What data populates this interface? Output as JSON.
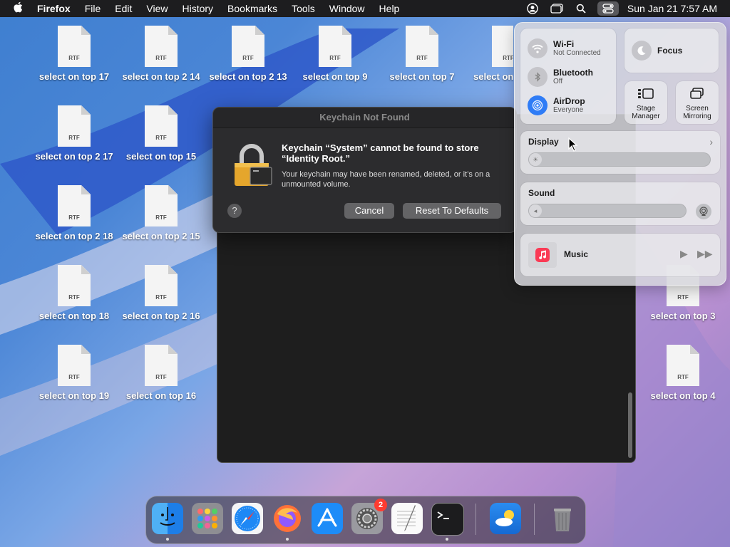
{
  "menubar": {
    "app_name": "Firefox",
    "menus": [
      "File",
      "Edit",
      "View",
      "History",
      "Bookmarks",
      "Tools",
      "Window",
      "Help"
    ],
    "clock": "Sun Jan 21  7:57 AM",
    "icons": [
      "user-icon",
      "window-icon",
      "search-icon",
      "control-center-icon"
    ]
  },
  "desktop": {
    "file_ext": "RTF",
    "files": [
      "select on top 17",
      "select on top 2 14",
      "select on top 2 13",
      "select on top 9",
      "select on top 7",
      "select on",
      "select on top 2 17",
      "select on top 15",
      "select on top 2 18",
      "select on top 2 15",
      "select on top 18",
      "select on top 2 16",
      "select on top 19",
      "select on top 16",
      "select on top 3",
      "select on top 4"
    ]
  },
  "dialog": {
    "title": "Keychain Not Found",
    "heading": "Keychain “System” cannot be found to store “Identity Root.”",
    "body": "Your keychain may have been renamed, deleted, or it’s on a unmounted volume.",
    "help_label": "?",
    "cancel_label": "Cancel",
    "reset_label": "Reset To Defaults"
  },
  "control_center": {
    "wifi": {
      "title": "Wi-Fi",
      "status": "Not Connected"
    },
    "bluetooth": {
      "title": "Bluetooth",
      "status": "Off"
    },
    "airdrop": {
      "title": "AirDrop",
      "status": "Everyone"
    },
    "focus": {
      "title": "Focus"
    },
    "stage_manager": {
      "line1": "Stage",
      "line2": "Manager"
    },
    "screen_mirroring": {
      "line1": "Screen",
      "line2": "Mirroring"
    },
    "display": {
      "title": "Display",
      "level": 0
    },
    "sound": {
      "title": "Sound",
      "level": 0
    },
    "music": {
      "title": "Music"
    },
    "accent": "#2f7cf6"
  },
  "dock": {
    "apps": [
      "finder",
      "launchpad",
      "safari",
      "firefox",
      "app-store",
      "system-settings",
      "textedit",
      "terminal",
      "weather",
      "trash"
    ],
    "system_settings_badge": "2"
  }
}
